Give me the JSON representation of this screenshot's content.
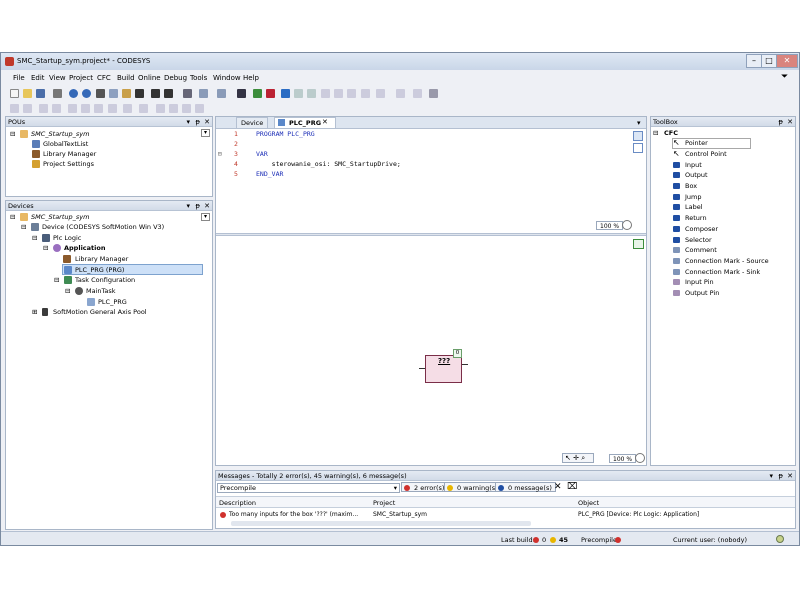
{
  "window": {
    "title": "SMC_Startup_sym.project* - CODESYS"
  },
  "menu": [
    "File",
    "Edit",
    "View",
    "Project",
    "CFC",
    "Build",
    "Online",
    "Debug",
    "Tools",
    "Window",
    "Help"
  ],
  "pous": {
    "title": "POUs",
    "items": [
      "SMC_Startup_sym",
      "GlobalTextList",
      "Library Manager",
      "Project Settings"
    ]
  },
  "devices": {
    "title": "Devices",
    "items": [
      "SMC_Startup_sym",
      "Device (CODESYS SoftMotion Win V3)",
      "Plc Logic",
      "Application",
      "Library Manager",
      "PLC_PRG (PRG)",
      "Task Configuration",
      "MainTask",
      "PLC_PRG",
      "SoftMotion General Axis Pool"
    ]
  },
  "editor": {
    "tabs": [
      "Device",
      "PLC_PRG"
    ],
    "close_glyph": "✕",
    "code": [
      {
        "n": "1",
        "text": "PROGRAM PLC_PRG"
      },
      {
        "n": "2",
        "text": ""
      },
      {
        "n": "3",
        "text": "VAR"
      },
      {
        "n": "4",
        "text": "    sterowanie_osi: SMC_StartupDrive;"
      },
      {
        "n": "5",
        "text": "END_VAR"
      }
    ],
    "zoom_top": "100 %",
    "zoom_bottom": "100 %",
    "box_label": "???",
    "box_badge": "0"
  },
  "toolbox": {
    "title": "ToolBox",
    "category": "CFC",
    "items": [
      "Pointer",
      "Control Point",
      "Input",
      "Output",
      "Box",
      "Jump",
      "Label",
      "Return",
      "Composer",
      "Selector",
      "Comment",
      "Connection Mark - Source",
      "Connection Mark - Sink",
      "Input Pin",
      "Output Pin"
    ]
  },
  "messages": {
    "title": "Messages - Totally 2 error(s), 45 warning(s), 6 message(s)",
    "source": "Precompile",
    "errors": "2 error(s)",
    "warnings": "0 warning(s)",
    "msgs": "0 message(s)",
    "columns": [
      "Description",
      "Project",
      "Object"
    ],
    "rows": [
      {
        "description": "Too many inputs for the box '???' (maxim...",
        "project": "SMC_Startup_sym",
        "object": "PLC_PRG [Device: Plc Logic: Application]"
      }
    ]
  },
  "statusbar": {
    "last_build_label": "Last build:",
    "errors": "0",
    "warnings": "45",
    "precompile_label": "Precompile:",
    "user": "Current user: (nobody)"
  },
  "colors": {
    "error": "#d0312d",
    "warning": "#e8b600",
    "info": "#1f4ea3",
    "accent": "#dcb8c8"
  }
}
